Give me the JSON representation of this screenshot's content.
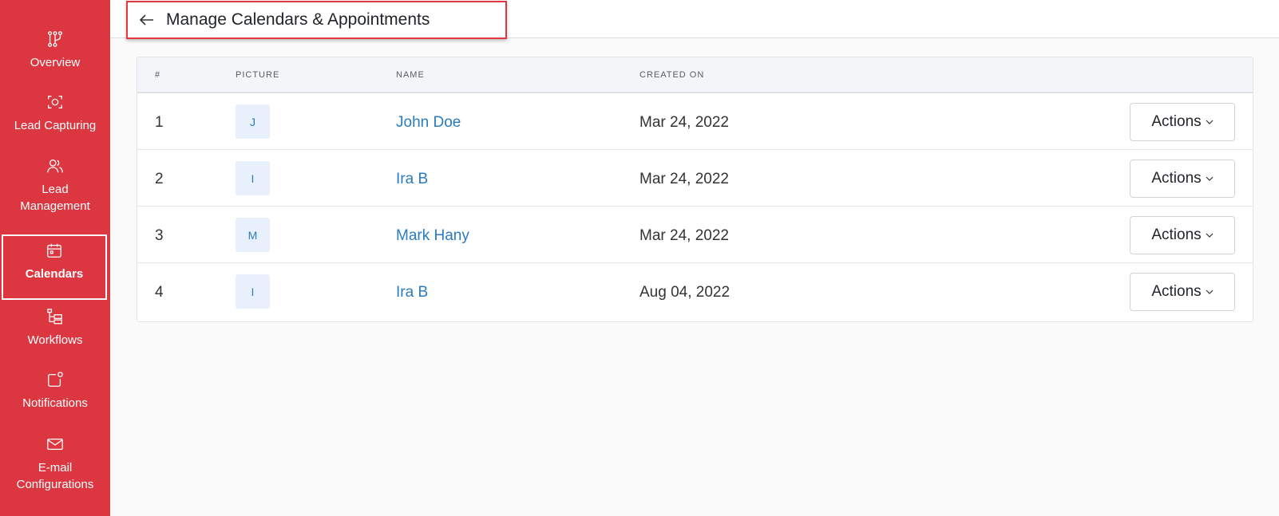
{
  "sidebar": {
    "items": [
      {
        "label": "Overview",
        "icon": "flow-icon"
      },
      {
        "label": "Lead Capturing",
        "icon": "target-icon"
      },
      {
        "label": "Lead Management",
        "icon": "users-icon"
      },
      {
        "label": "Calendars",
        "icon": "calendar-icon",
        "active": true
      },
      {
        "label": "Workflows",
        "icon": "workflow-icon"
      },
      {
        "label": "Notifications",
        "icon": "notification-icon"
      },
      {
        "label": "E-mail Configurations",
        "icon": "mail-icon"
      }
    ]
  },
  "header": {
    "title": "Manage Calendars & Appointments"
  },
  "table": {
    "columns": [
      "#",
      "PICTURE",
      "NAME",
      "CREATED ON"
    ],
    "rows": [
      {
        "num": "1",
        "initial": "J",
        "name": "John Doe",
        "created": "Mar 24, 2022",
        "action": "Actions"
      },
      {
        "num": "2",
        "initial": "I",
        "name": "Ira B",
        "created": "Mar 24, 2022",
        "action": "Actions"
      },
      {
        "num": "3",
        "initial": "M",
        "name": "Mark Hany",
        "created": "Mar 24, 2022",
        "action": "Actions"
      },
      {
        "num": "4",
        "initial": "I",
        "name": "Ira B",
        "created": "Aug 04, 2022",
        "action": "Actions"
      }
    ]
  },
  "colors": {
    "sidebar": "#dc3740",
    "link": "#2a7bc0",
    "highlight": "#e2373f"
  }
}
